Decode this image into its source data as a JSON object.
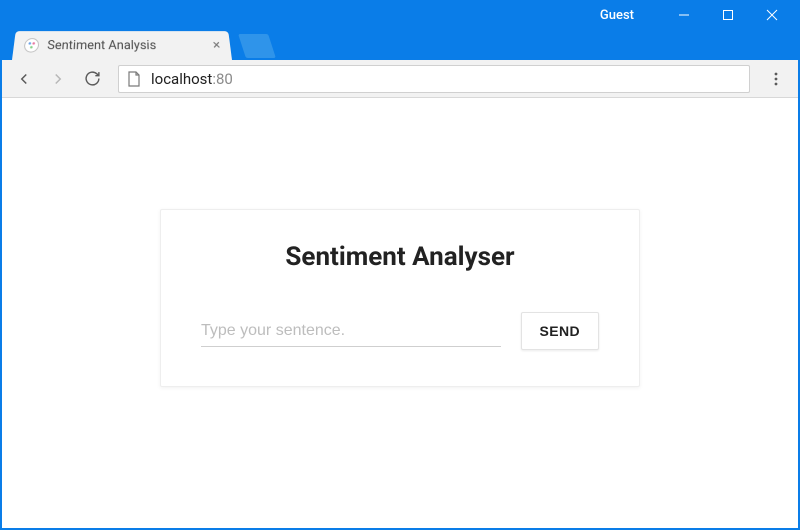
{
  "window": {
    "guest_label": "Guest"
  },
  "tab": {
    "title": "Sentiment Analysis"
  },
  "address": {
    "host": "localhost",
    "port": ":80"
  },
  "app": {
    "heading": "Sentiment Analyser",
    "input_placeholder": "Type your sentence.",
    "input_value": "",
    "send_label": "SEND"
  }
}
